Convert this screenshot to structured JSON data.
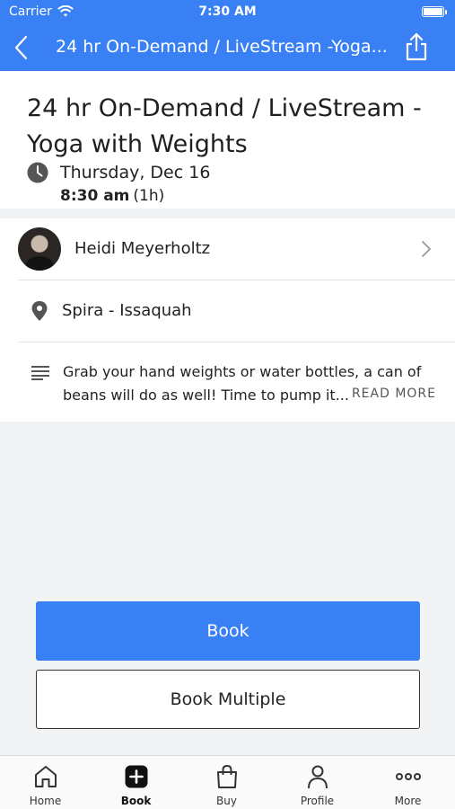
{
  "status_bar": {
    "carrier": "Carrier",
    "time": "7:30 AM"
  },
  "nav": {
    "title": "24 hr On-Demand / LiveStream -Yoga..."
  },
  "class": {
    "title": "24 hr On-Demand / LiveStream -Yoga with Weights",
    "date": "Thursday, Dec 16",
    "start_time": "8:30 am",
    "duration": "(1h)"
  },
  "instructor": {
    "name": "Heidi Meyerholtz"
  },
  "location": {
    "name": "Spira - Issaquah"
  },
  "description": {
    "text": "Grab your hand weights or water bottles, a can of beans will do as well! Time to pump it...",
    "read_more": "READ MORE"
  },
  "actions": {
    "book": "Book",
    "book_multiple": "Book Multiple"
  },
  "tabs": [
    {
      "label": "Home",
      "icon": "home-icon"
    },
    {
      "label": "Book",
      "icon": "plus-square-icon",
      "active": true
    },
    {
      "label": "Buy",
      "icon": "shopping-bag-icon"
    },
    {
      "label": "Profile",
      "icon": "person-icon"
    },
    {
      "label": "More",
      "icon": "more-dots-icon"
    }
  ],
  "colors": {
    "accent": "#3a80f5"
  }
}
